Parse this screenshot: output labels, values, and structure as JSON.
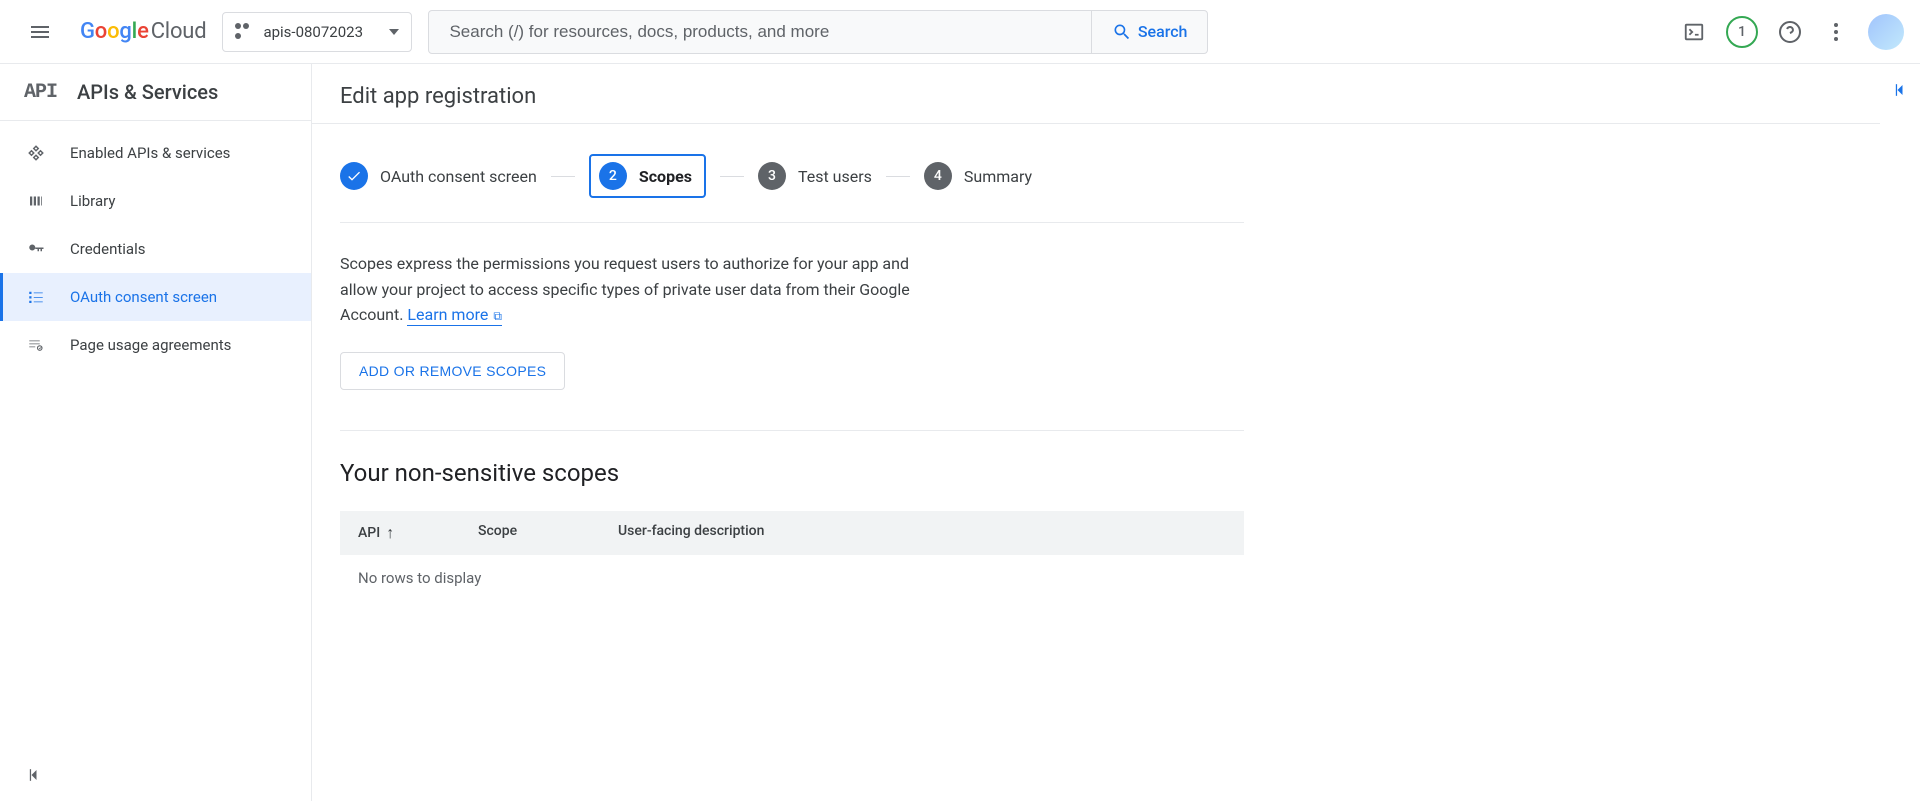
{
  "header": {
    "logo_text": "Google",
    "logo_suffix": " Cloud",
    "project_name": "apis-08072023",
    "search_placeholder": "Search (/) for resources, docs, products, and more",
    "search_button": "Search",
    "badge_count": "1"
  },
  "sidebar": {
    "api_logo": "API",
    "title": "APIs & Services",
    "items": [
      {
        "label": "Enabled APIs & services"
      },
      {
        "label": "Library"
      },
      {
        "label": "Credentials"
      },
      {
        "label": "OAuth consent screen"
      },
      {
        "label": "Page usage agreements"
      }
    ]
  },
  "page": {
    "title": "Edit app registration",
    "stepper": [
      {
        "num": "✓",
        "label": "OAuth consent screen",
        "state": "done"
      },
      {
        "num": "2",
        "label": "Scopes",
        "state": "active"
      },
      {
        "num": "3",
        "label": "Test users",
        "state": ""
      },
      {
        "num": "4",
        "label": "Summary",
        "state": ""
      }
    ],
    "scopes_desc": "Scopes express the permissions you request users to authorize for your app and allow your project to access specific types of private user data from their Google Account. ",
    "learn_more": "Learn more",
    "add_remove_btn": "ADD OR REMOVE SCOPES",
    "table_title": "Your non-sensitive scopes",
    "columns": {
      "api": "API",
      "scope": "Scope",
      "desc": "User-facing description"
    },
    "empty_text": "No rows to display"
  }
}
